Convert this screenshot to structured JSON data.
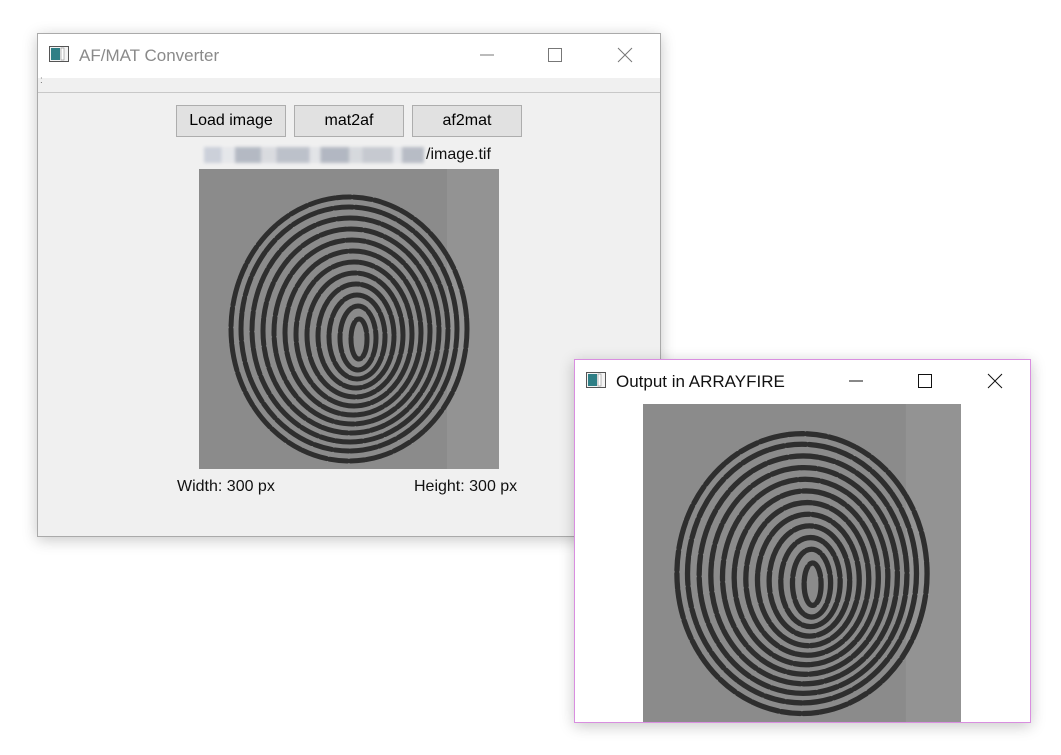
{
  "main_window": {
    "title": "AF/MAT Converter",
    "menu_grip": ":",
    "buttons": {
      "load": "Load image",
      "mat2af": "mat2af",
      "af2mat": "af2mat"
    },
    "file_path_suffix": "/image.tif",
    "width_label": "Width: 300 px",
    "height_label": "Height: 300 px"
  },
  "output_window": {
    "title": "Output in ARRAYFIRE"
  },
  "icons": [
    "app-icon",
    "minimize-icon",
    "maximize-icon",
    "close-icon",
    "fingerprint-image"
  ]
}
